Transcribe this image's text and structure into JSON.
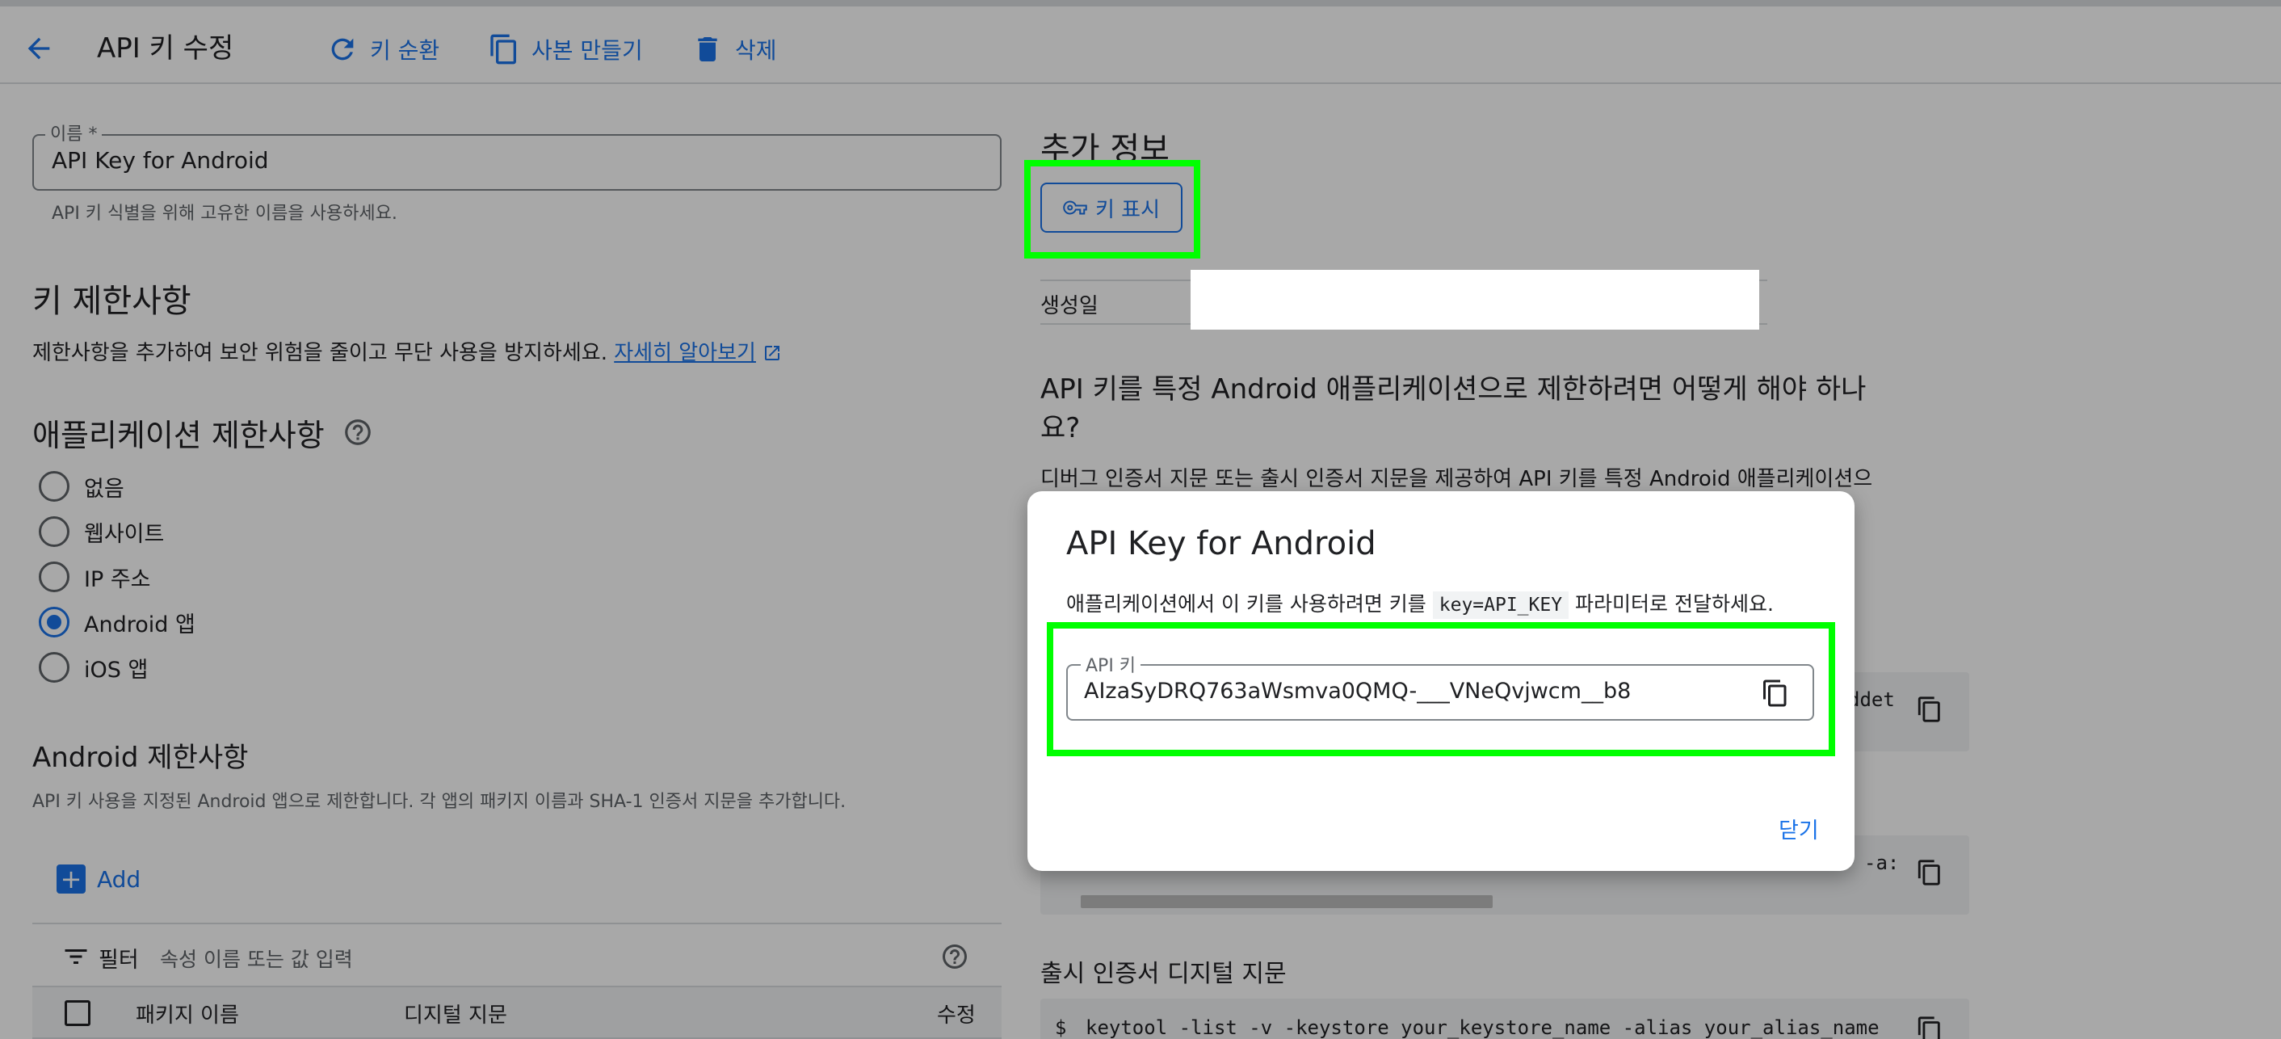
{
  "header": {
    "title": "API 키 수정",
    "rotate_label": "키 순환",
    "copy_label": "사본 만들기",
    "delete_label": "삭제"
  },
  "name_field": {
    "label": "이름 *",
    "value": "API Key for Android",
    "hint": "API 키 식별을 위해 고유한 이름을 사용하세요."
  },
  "restrictions": {
    "title": "키 제한사항",
    "desc": "제한사항을 추가하여 보안 위험을 줄이고 무단 사용을 방지하세요.",
    "learn_more": "자세히 알아보기"
  },
  "app_restrictions": {
    "title": "애플리케이션 제한사항",
    "options": [
      "없음",
      "웹사이트",
      "IP 주소",
      "Android 앱",
      "iOS 앱"
    ],
    "selected_index": 3
  },
  "android_restrictions": {
    "title": "Android 제한사항",
    "desc": "API 키 사용을 지정된 Android 앱으로 제한합니다. 각 앱의 패키지 이름과 SHA-1 인증서 지문을 추가합니다.",
    "add_label": "Add",
    "filter_label": "필터",
    "filter_placeholder": "속성 이름 또는 값 입력",
    "columns": [
      "패키지 이름",
      "디지털 지문",
      "수정"
    ]
  },
  "info": {
    "title": "추가 정보",
    "show_key_label": "키 표시",
    "created_label": "생성일",
    "created_value": "",
    "howto_title_line1": "API 키를 특정 Android 애플리케이션으로 제한하려면 어떻게 해야 하나",
    "howto_title_line2": "요?",
    "howto_desc": "디버그 인증서 지문 또는 출시 인증서 지문을 제공하여 API 키를 특정 Android 애플리케이션으",
    "code1_tail": "ddet",
    "code2_tail": "-a:",
    "release_title": "출시 인증서 디지털 지문",
    "release_cmd_prompt": "$",
    "release_cmd": "keytool -list -v -keystore your_keystore_name -alias your_alias_name"
  },
  "dialog": {
    "title": "API Key for Android",
    "desc_before": "애플리케이션에서 이 키를 사용하려면 키를",
    "desc_code": "key=API_KEY",
    "desc_after": "파라미터로 전달하세요.",
    "key_label": "API 키",
    "key_value": "AIzaSyDRQ763aWsmva0QMQ-___VNeQvjwcm__b8",
    "close_label": "닫기"
  },
  "colors": {
    "accent": "#1a73e8",
    "highlight": "#00ff00",
    "scrim": "rgba(0,0,0,0.34)"
  }
}
